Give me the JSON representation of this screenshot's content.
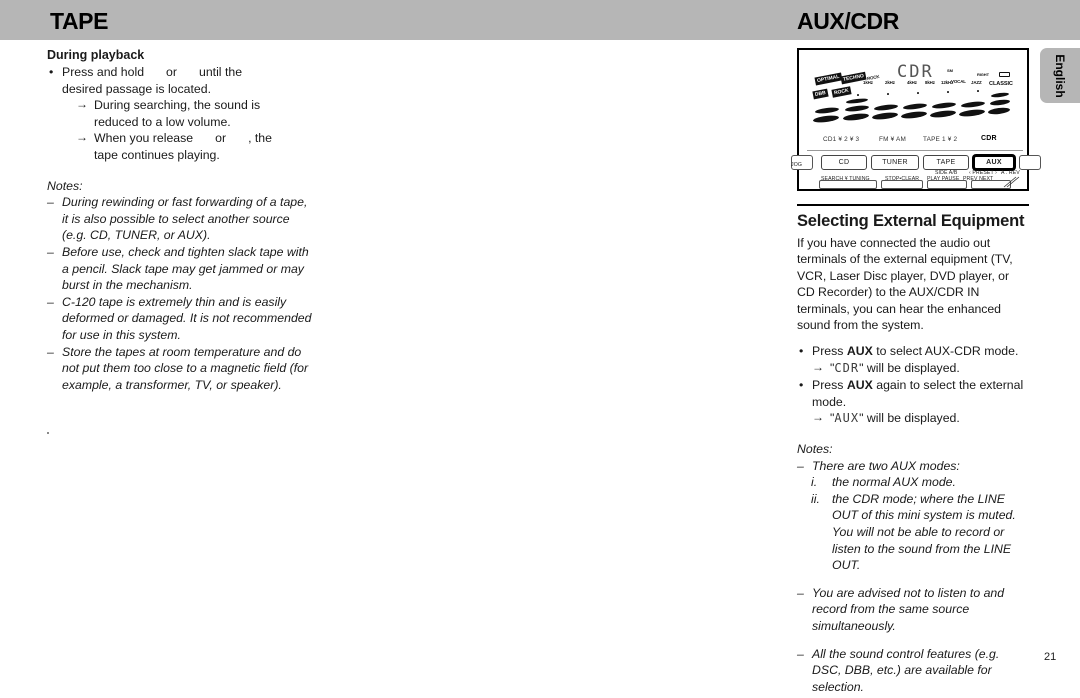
{
  "header": {
    "left_title": "TAPE",
    "right_title": "AUX/CDR",
    "band_color": "#b6b6b6"
  },
  "language_tab": {
    "label": "English"
  },
  "page_number": "21",
  "left_column": {
    "sub_heading": "During playback",
    "bullet": {
      "dot": "•",
      "text_before": "Press and hold",
      "text_middle": "or",
      "text_after": "until the",
      "line2": "desired passage is located."
    },
    "arrows": [
      {
        "marker": "→",
        "line1": "During searching, the sound is",
        "line2": "reduced to a low volume."
      },
      {
        "marker": "→",
        "pre": "When you release",
        "mid": "or",
        "post": ", the",
        "line2": "tape continues playing."
      }
    ],
    "notes_title": "Notes:",
    "notes": [
      {
        "dash": "–",
        "text": "During rewinding or fast forwarding of a tape, it is also possible to select another source (e.g. CD, TUNER, or AUX)."
      },
      {
        "dash": "–",
        "text": "Before use, check and tighten slack tape with a pencil.  Slack tape may get jammed or may burst in the mechanism."
      },
      {
        "dash": "–",
        "text": "C-120 tape is extremely thin and is easily deformed or damaged.  It is not recommended for use in this system."
      },
      {
        "dash": "–",
        "text": "Store the tapes at room temperature and do not put them too close to a magnetic field (for example, a transformer, TV, or speaker)."
      }
    ]
  },
  "device": {
    "lcd_word": "CDR",
    "dsc_tags": [
      "OPTIMAL",
      "TECHNO"
    ],
    "dbb_tag": "DBB",
    "rock_tag": "ROCK",
    "mode_tags": [
      "VOCAL",
      "JAZZ",
      "CLASSIC"
    ],
    "indicator_right": "RIGHT",
    "indicator_sm": "SM",
    "eq_tick_labels": [
      "250Hz",
      "700Hz",
      "1kHz",
      "2kHz",
      "4kHz",
      "8kHz",
      "12kHz"
    ],
    "source_labels": [
      {
        "text": "CD1 ¥ 2 ¥ 3",
        "bold": false
      },
      {
        "text": "FM ¥ AM",
        "bold": false
      },
      {
        "text": "TAPE 1 ¥ 2",
        "bold": false
      },
      {
        "text": "CDR",
        "bold": true
      }
    ],
    "buttons": [
      {
        "label": "CD",
        "selected": false
      },
      {
        "label": "TUNER",
        "selected": false
      },
      {
        "label": "TAPE",
        "selected": false
      },
      {
        "label": "AUX",
        "selected": true
      }
    ],
    "sub_labels": [
      "SEARCH ¥ TUNING",
      "STOP•CLEAR",
      "SIDE A/B",
      "PLAY    PAUSE",
      "‹  PRESET  ›",
      "PREV          NEXT",
      "JOG",
      "A . REV"
    ]
  },
  "right_column": {
    "section_heading": "Selecting External Equipment",
    "intro": "If you have connected the audio out terminals of the external equipment (TV, VCR, Laser Disc player, DVD player, or CD Recorder) to the AUX/CDR IN terminals, you can hear the enhanced sound from the system.",
    "bullets": [
      {
        "dot": "•",
        "pre": "Press ",
        "strong": "AUX",
        "post": " to select AUX-CDR mode.",
        "arrow": {
          "marker": "→",
          "pre": "\"",
          "lcd": "CDR",
          "post": "\" will be displayed."
        }
      },
      {
        "dot": "•",
        "pre": "Press ",
        "strong": "AUX",
        "post": " again to select the external mode.",
        "arrow": {
          "marker": "→",
          "pre": "\"",
          "lcd": "AUX",
          "post": "\" will be displayed."
        }
      }
    ],
    "notes_title": "Notes:",
    "notes": [
      {
        "dash": "–",
        "text": "There are two AUX modes:"
      },
      {
        "dash": "–",
        "text": "You are advised not to listen to and record from the same source simultaneously."
      },
      {
        "dash": "–",
        "text": "All the sound control features (e.g. DSC, DBB, etc.) are available for selection."
      }
    ],
    "roman_items": [
      {
        "numeral": "i.",
        "text": "the normal AUX mode."
      },
      {
        "numeral": "ii.",
        "text": "the CDR mode; where the LINE OUT of this mini system is muted. You will not be able to record or listen to the sound from the LINE OUT."
      }
    ]
  }
}
